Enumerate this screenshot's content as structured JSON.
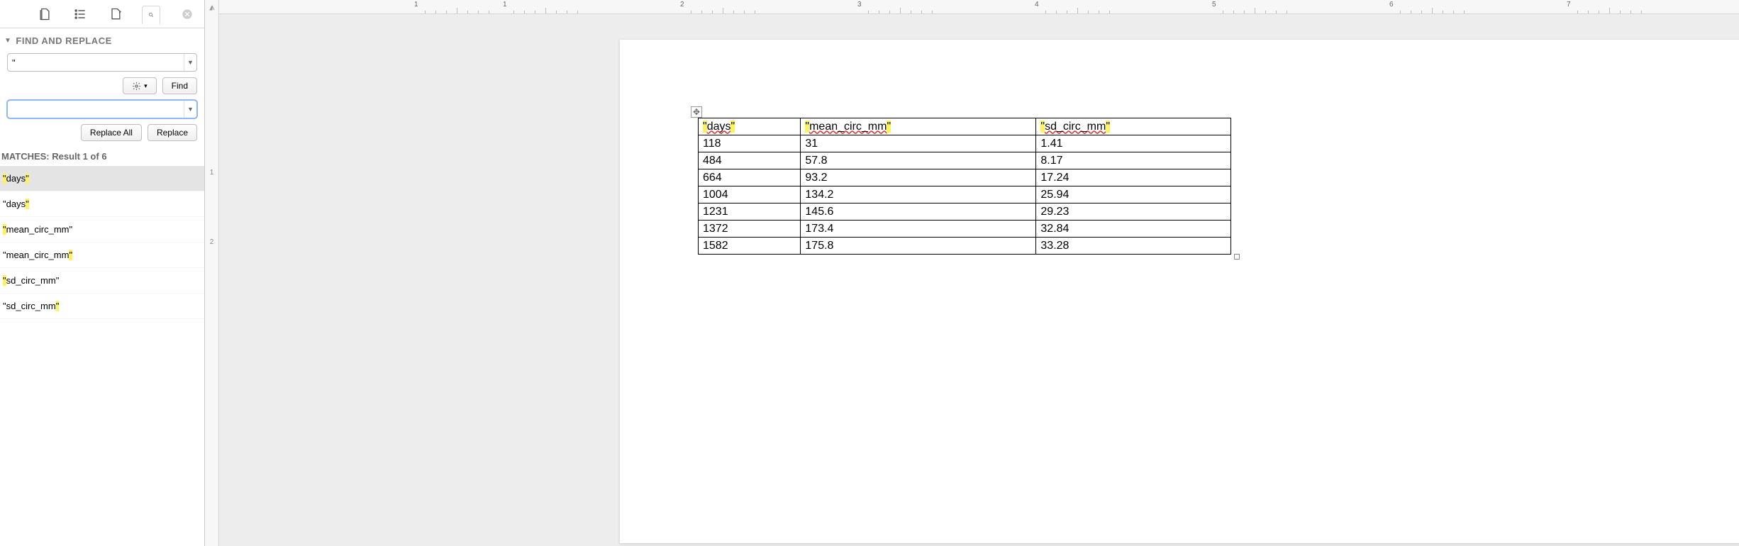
{
  "panel": {
    "title": "FIND AND REPLACE",
    "find_value": "\"",
    "replace_value": "",
    "find_btn": "Find",
    "replace_btn": "Replace",
    "replace_all_btn": "Replace All",
    "gear_caret": "▾",
    "matches_label": "MATCHES: Result 1 of 6",
    "matches": [
      {
        "pre_hl": "\"",
        "body": "days",
        "post_hl": "\"",
        "selected": true
      },
      {
        "pre": "\"days",
        "post_hl": "\"",
        "selected": false
      },
      {
        "pre_hl": "\"",
        "body": "mean_circ_mm\"",
        "selected": false
      },
      {
        "pre": "\"mean_circ_mm",
        "post_hl": "\"",
        "selected": false
      },
      {
        "pre_hl": "\"",
        "body": "sd_circ_mm\"",
        "selected": false
      },
      {
        "pre": "\"sd_circ_mm",
        "post_hl": "\"",
        "selected": false
      }
    ]
  },
  "ruler": {
    "numbers": [
      "1",
      "1",
      "2",
      "3",
      "4",
      "5",
      "6",
      "7"
    ]
  },
  "table": {
    "headers": [
      {
        "q1": "\"",
        "text": "days",
        "q2": "\""
      },
      {
        "q1": "\"",
        "text": "mean_circ_mm",
        "q2": "\""
      },
      {
        "q1": "\"",
        "text": "sd_circ_mm",
        "q2": "\""
      }
    ],
    "rows": [
      [
        "118",
        "31",
        "1.41"
      ],
      [
        "484",
        "57.8",
        "8.17"
      ],
      [
        "664",
        "93.2",
        "17.24"
      ],
      [
        "1004",
        "134.2",
        "25.94"
      ],
      [
        "1231",
        "145.6",
        "29.23"
      ],
      [
        "1372",
        "173.4",
        "32.84"
      ],
      [
        "1582",
        "175.8",
        "33.28"
      ]
    ]
  },
  "navigator": {
    "page_labels": [
      "1",
      "2"
    ]
  }
}
